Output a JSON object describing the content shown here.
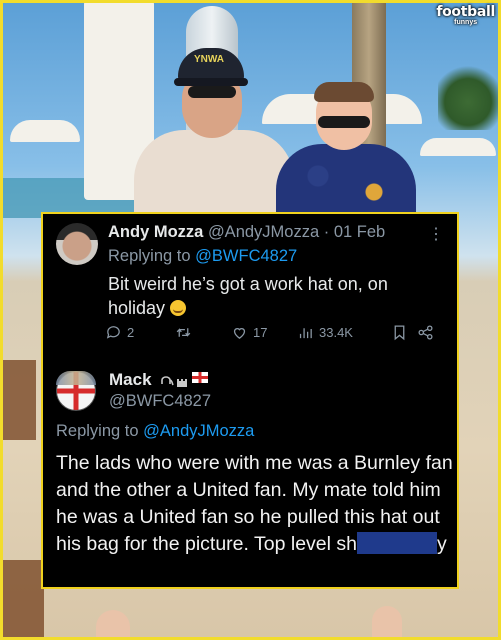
{
  "brand": {
    "line1": "football",
    "line2": "funnys"
  },
  "photo": {
    "cap_text": "YNWA"
  },
  "tweet1": {
    "name": "Andy Mozza",
    "handle": "@AndyJMozza",
    "separator": "·",
    "date": "01 Feb",
    "replying_prefix": "Replying to",
    "replying_handle": "@BWFC4827",
    "text_line1": "Bit weird he’s got a work hat on, on",
    "text_line2": "holiday",
    "emoji": "smiling-face",
    "more_label": "⋮",
    "actions": {
      "reply_count": "2",
      "retweet_count": "",
      "like_count": "17",
      "views_count": "33.4K"
    }
  },
  "tweet2": {
    "name": "Mack",
    "name_emojis": [
      "elephant-icon",
      "castle-icon",
      "england-flag-icon"
    ],
    "handle": "@BWFC4827",
    "replying_prefix": "Replying to",
    "replying_handle": "@AndyJMozza",
    "text_main": "The lads who were with me was a Burnley fan and the other a United fan. My mate told him he was a United fan so he pulled this hat out his bag for the picture. Top level sh",
    "text_after_redaction": "y"
  },
  "colors": {
    "card_bg": "#000000",
    "card_border": "#f0d21e",
    "link": "#1d9bf0",
    "muted": "#8b98a5",
    "redaction": "#1f3a8c"
  }
}
